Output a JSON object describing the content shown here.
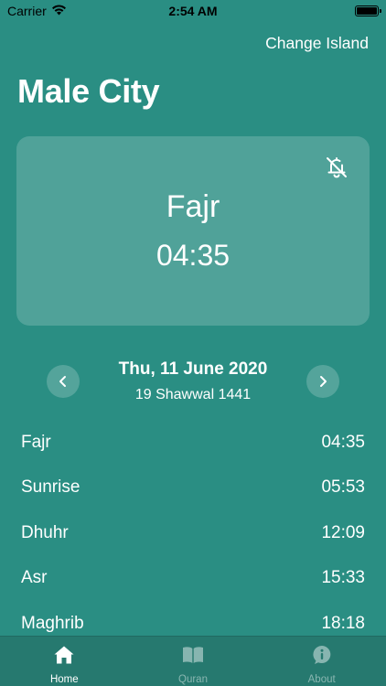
{
  "status_bar": {
    "carrier": "Carrier",
    "time": "2:54 AM"
  },
  "header": {
    "change_island_label": "Change Island",
    "city": "Male City"
  },
  "current_prayer": {
    "name": "Fajr",
    "time": "04:35",
    "icon": "bell-slash-icon"
  },
  "date": {
    "gregorian": "Thu, 11 June 2020",
    "hijri": "19 Shawwal 1441"
  },
  "prayers": [
    {
      "name": "Fajr",
      "time": "04:35"
    },
    {
      "name": "Sunrise",
      "time": "05:53"
    },
    {
      "name": "Dhuhr",
      "time": "12:09"
    },
    {
      "name": "Asr",
      "time": "15:33"
    },
    {
      "name": "Maghrib",
      "time": "18:18"
    }
  ],
  "tabs": [
    {
      "label": "Home",
      "icon": "home-icon",
      "active": true
    },
    {
      "label": "Quran",
      "icon": "book-icon",
      "active": false
    },
    {
      "label": "About",
      "icon": "info-icon",
      "active": false
    }
  ],
  "colors": {
    "background": "#2a8e83",
    "tab_bar": "#26796f"
  }
}
